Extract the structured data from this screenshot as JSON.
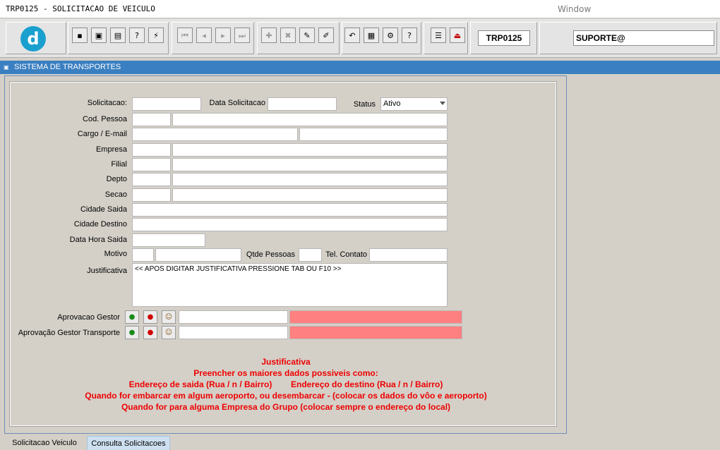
{
  "window": {
    "title": "TRP0125 - SOLICITACAO DE VEICULO",
    "menu": "Window"
  },
  "toolbar": {
    "logo_letter": "d",
    "form_code": "TRP0125",
    "user": "SUPORTE@",
    "buttons": [
      {
        "name": "save-icon",
        "glyph": "▪"
      },
      {
        "name": "window-icon",
        "glyph": "▣"
      },
      {
        "name": "print-icon",
        "glyph": "▤"
      },
      {
        "name": "query-icon",
        "glyph": "?"
      },
      {
        "name": "execute-query-icon",
        "glyph": "⚡"
      },
      {
        "name": "first-record-icon",
        "glyph": "⏮"
      },
      {
        "name": "previous-record-icon",
        "glyph": "◂"
      },
      {
        "name": "next-record-icon",
        "glyph": "▸"
      },
      {
        "name": "last-record-icon",
        "glyph": "⏭"
      },
      {
        "name": "insert-record-icon",
        "glyph": "✚"
      },
      {
        "name": "delete-record-icon",
        "glyph": "✖"
      },
      {
        "name": "edit-record-icon",
        "glyph": "✎"
      },
      {
        "name": "clear-icon",
        "glyph": "✐"
      },
      {
        "name": "undo-icon",
        "glyph": "↶"
      },
      {
        "name": "clipboard-icon",
        "glyph": "▦"
      },
      {
        "name": "tools-icon",
        "glyph": "⚙"
      },
      {
        "name": "help-icon",
        "glyph": "?"
      },
      {
        "name": "menu-icon",
        "glyph": "☰"
      },
      {
        "name": "exit-icon",
        "glyph": "⏏"
      }
    ]
  },
  "system_bar": {
    "title": "SISTEMA DE TRANSPORTES"
  },
  "form": {
    "labels": {
      "solicitacao": "Solicitacao:",
      "data_solicitacao": "Data Solicitacao",
      "status": "Status",
      "cod_pessoa": "Cod. Pessoa",
      "cargo_email": "Cargo / E-mail",
      "empresa": "Empresa",
      "filial": "Filial",
      "depto": "Depto",
      "secao": "Secao",
      "cidade_saida": "Cidade Saida",
      "cidade_destino": "Cidade Destino",
      "data_hora_saida": "Data Hora Saida",
      "motivo": "Motivo",
      "qtde_pessoas": "Qtde Pessoas",
      "tel_contato": "Tel. Contato",
      "justificativa": "Justificativa",
      "aprovacao_gestor": "Aprovacao Gestor",
      "aprovacao_gestor_transporte": "Aprovação Gestor Transporte"
    },
    "status_value": "Ativo",
    "justificativa_value": "<<  APOS DIGITAR JUSTIFICATIVA PRESSIONE   TAB   OU   F10   >>"
  },
  "notes": [
    "Justificativa",
    "Preencher os maiores dados possiveis como:",
    "Endereço de saida (Rua / n / Bairro)        Endereço do destino (Rua / n / Bairro)",
    "Quando for embarcar em algum aeroporto, ou desembarcar - (colocar os dados do vôo e aeroporto)",
    "Quando for para alguma Empresa do Grupo (colocar sempre o endereço do local)"
  ],
  "tabs": [
    {
      "label": "Solicitacao Veiculo",
      "active": true
    },
    {
      "label": "Consulta Solicitacoes",
      "active": false
    }
  ],
  "colors": {
    "system_bar": "#3a7fc1",
    "approval_status": "#ff8080",
    "notes": "#ee0000"
  }
}
